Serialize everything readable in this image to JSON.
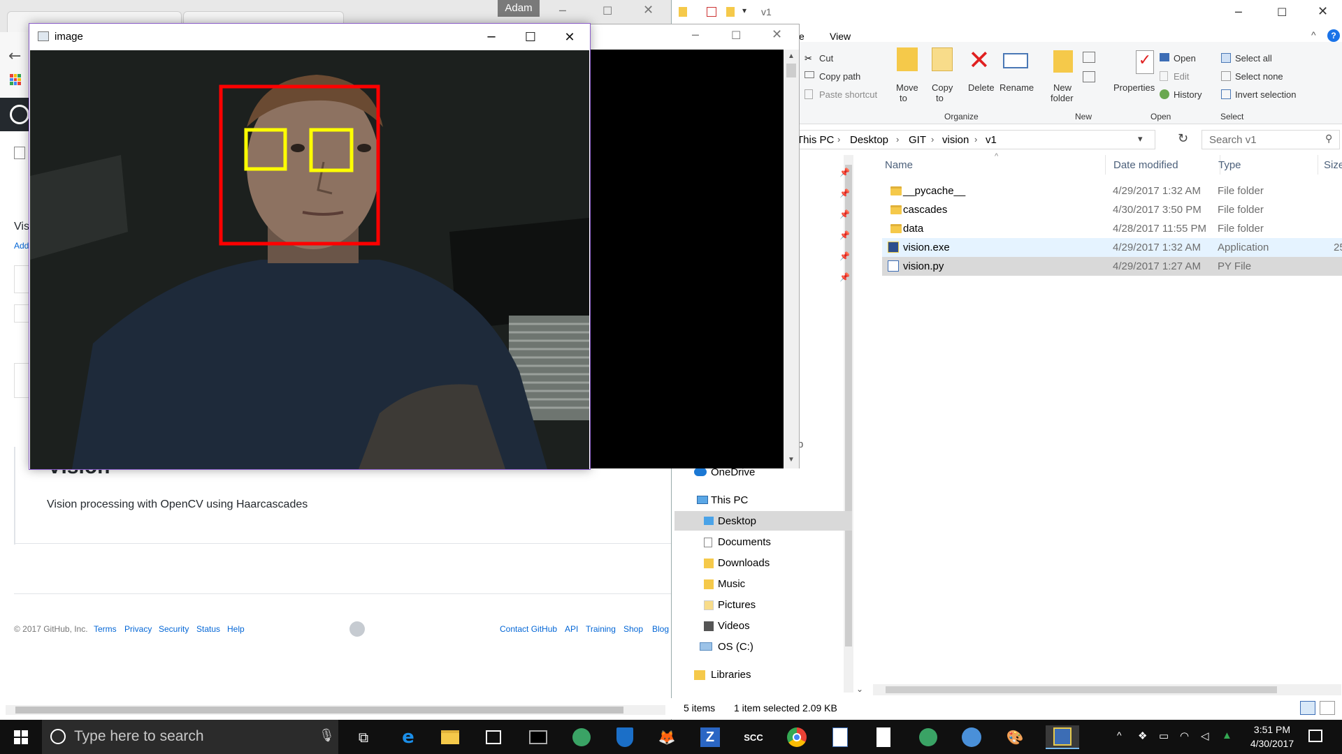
{
  "browser": {
    "partial_title": "Vis",
    "partial_link": "Add",
    "repo_title": "Vision",
    "description": "Vision processing with OpenCV using Haarcascades",
    "footer": {
      "copyright": "© 2017 GitHub, Inc.",
      "left_links": [
        "Terms",
        "Privacy",
        "Security",
        "Status",
        "Help"
      ],
      "right_links": [
        "Contact GitHub",
        "API",
        "Training",
        "Shop",
        "Blog"
      ]
    }
  },
  "top_user_label": "Adam",
  "image_window": {
    "title": "image",
    "detections": {
      "face_color": "#ff0000",
      "eye_color": "#ffff00"
    }
  },
  "explorer": {
    "title": "v1",
    "menu_partial": "e",
    "menu_view": "View",
    "ribbon": {
      "clipboard": {
        "cut": "Cut",
        "copy_path": "Copy path",
        "paste_shortcut": "Paste shortcut"
      },
      "organize": {
        "move_to_1": "Move",
        "move_to_2": "to",
        "copy_to_1": "Copy",
        "copy_to_2": "to",
        "delete": "Delete",
        "rename": "Rename",
        "label": "Organize"
      },
      "new": {
        "new_folder_1": "New",
        "new_folder_2": "folder",
        "label": "New"
      },
      "open": {
        "properties": "Properties",
        "open": "Open",
        "edit": "Edit",
        "history": "History",
        "label": "Open"
      },
      "select": {
        "select_all": "Select all",
        "select_none": "Select none",
        "invert": "Invert selection",
        "label": "Select"
      }
    },
    "breadcrumb": [
      "This PC",
      "Desktop",
      "GIT",
      "vision",
      "v1"
    ],
    "search_placeholder": "Search v1",
    "columns": {
      "name": "Name",
      "date": "Date modified",
      "type": "Type",
      "size": "Size"
    },
    "files": [
      {
        "name": "__pycache__",
        "date": "4/29/2017 1:32 AM",
        "type": "File folder",
        "size": "",
        "icon": "folder-icon"
      },
      {
        "name": "cascades",
        "date": "4/30/2017 3:50 PM",
        "type": "File folder",
        "size": "",
        "icon": "folder-icon"
      },
      {
        "name": "data",
        "date": "4/28/2017 11:55 PM",
        "type": "File folder",
        "size": "",
        "icon": "folder-icon"
      },
      {
        "name": "vision.exe",
        "date": "4/29/2017 1:32 AM",
        "type": "Application",
        "size": "25",
        "icon": "exe-icon"
      },
      {
        "name": "vision.py",
        "date": "4/29/2017 1:27 AM",
        "type": "PY File",
        "size": "",
        "icon": "python-file-icon"
      }
    ],
    "nav": {
      "onedrive": "OneDrive",
      "this_pc": "This PC",
      "desktop": "Desktop",
      "documents": "Documents",
      "downloads": "Downloads",
      "music": "Music",
      "pictures": "Pictures",
      "videos": "Videos",
      "os_c": "OS (C:)",
      "libraries": "Libraries",
      "partial_p": "p"
    },
    "status": {
      "items": "5 items",
      "selected": "1 item selected  2.09 KB"
    }
  },
  "taskbar": {
    "search_placeholder": "Type here to search",
    "scc_label": "SCC",
    "time": "3:51 PM",
    "date": "4/30/2017"
  }
}
